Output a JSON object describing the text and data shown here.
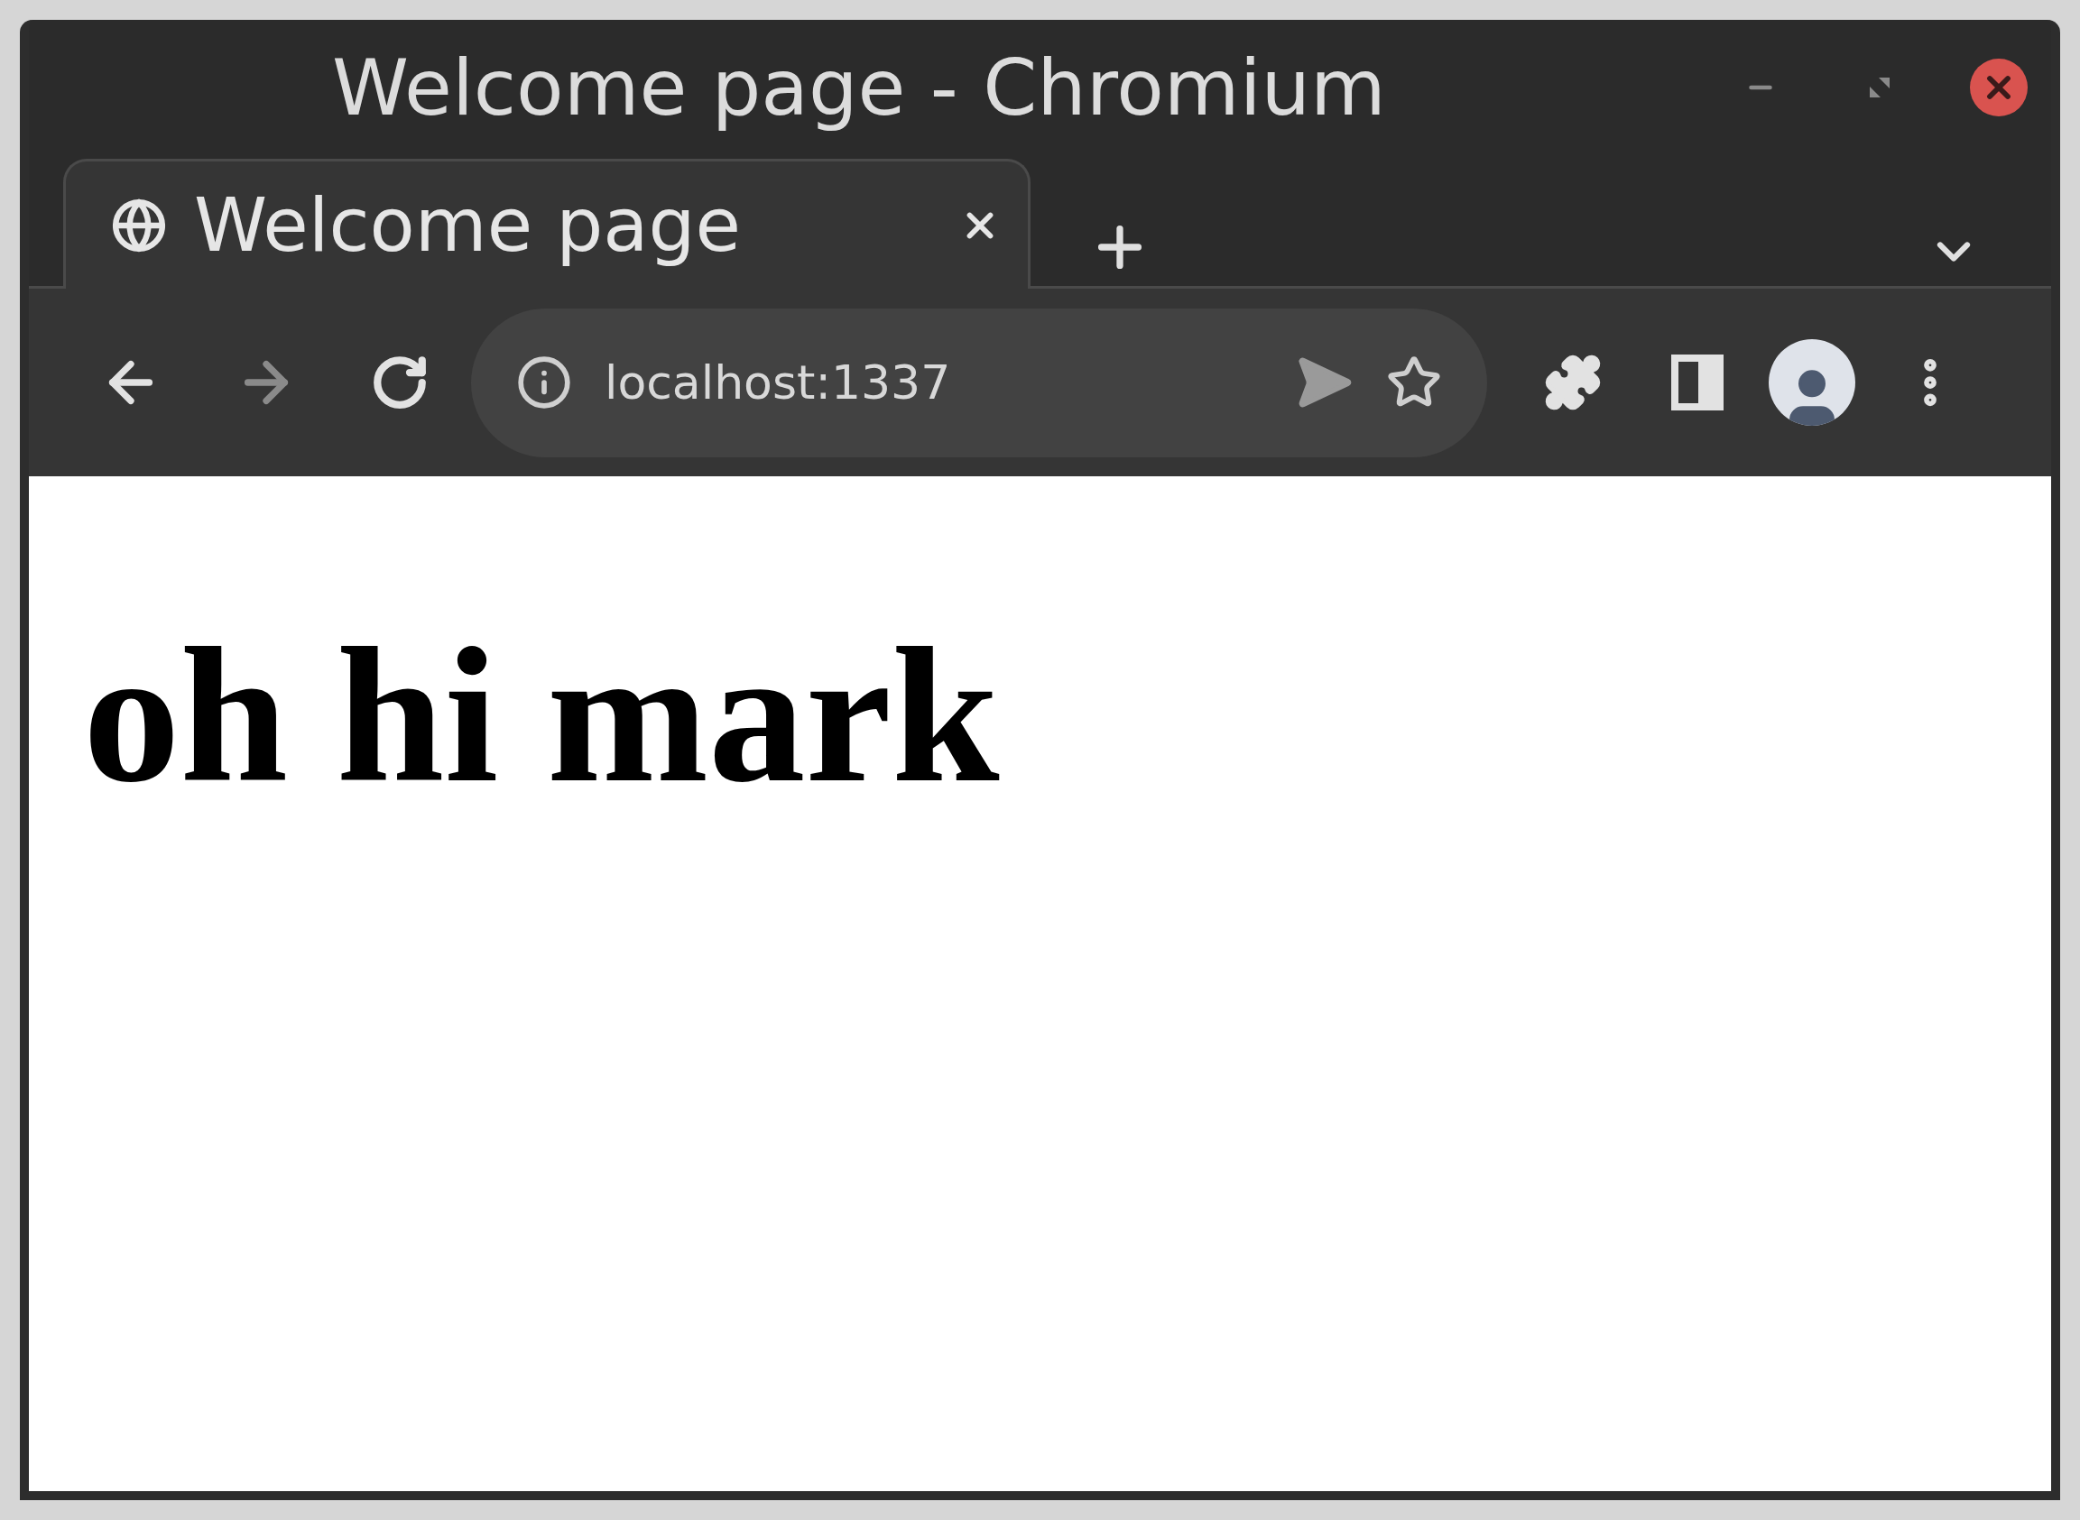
{
  "window": {
    "title": "Welcome page - Chromium"
  },
  "tabs": [
    {
      "label": "Welcome page",
      "selected": true
    }
  ],
  "navigation": {
    "back_disabled": false,
    "forward_disabled": true
  },
  "address_bar": {
    "value": "localhost:1337"
  },
  "page": {
    "heading": "oh hi mark"
  }
}
